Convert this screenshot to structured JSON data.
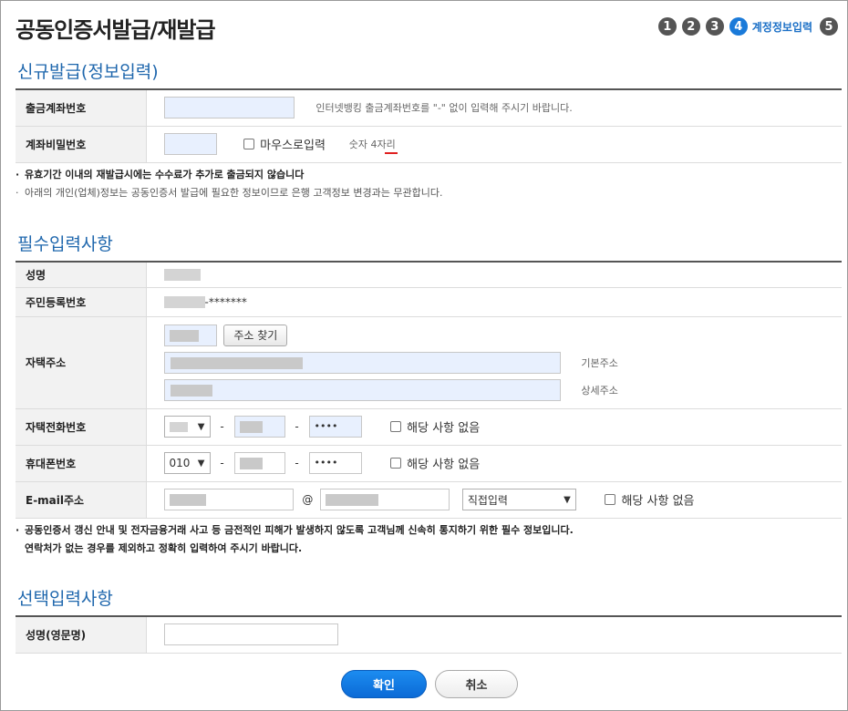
{
  "page_title": "공동인증서발급/재발급",
  "steps": {
    "items": [
      "1",
      "2",
      "3",
      "4",
      "5"
    ],
    "active_label": "계정정보입력"
  },
  "section1": {
    "title": "신규발급(정보입력)",
    "account_number_label": "출금계좌번호",
    "account_number_hint": "인터넷뱅킹 출금계좌번호를 \"-\" 없이 입력해 주시기 바랍니다.",
    "account_password_label": "계좌비밀번호",
    "mouse_input_label": "마우스로입력",
    "password_hint": "숫자 4자리",
    "note1": "유효기간 이내의 재발급시에는 수수료가 추가로 출금되지 않습니다",
    "note2": "아래의 개인(업체)정보는 공동인증서 발급에 필요한 정보이므로 은행 고객정보 변경과는 무관합니다."
  },
  "section2": {
    "title": "필수입력사항",
    "name_label": "성명",
    "rrn_label": "주민등록번호",
    "rrn_suffix": "-*******",
    "address_label": "자택주소",
    "address_search_button": "주소 찾기",
    "basic_address_label": "기본주소",
    "detail_address_label": "상세주소",
    "home_phone_label": "자택전화번호",
    "home_phone_last": "••••",
    "not_applicable": "해당 사항 없음",
    "mobile_label": "휴대폰번호",
    "mobile_prefix": "010",
    "mobile_last": "••••",
    "email_label": "E-mail주소",
    "email_at": "@",
    "email_domain_select": "직접입력",
    "dash": "-",
    "note1": "공동인증서 갱신 안내 및 전자금융거래 사고 등 금전적인 피해가 발생하지 않도록 고객님께 신속히 통지하기 위한 필수 정보입니다.",
    "note2": "연락처가 없는 경우를 제외하고 정확히 입력하여 주시기 바랍니다."
  },
  "section3": {
    "title": "선택입력사항",
    "english_name_label": "성명(영문명)"
  },
  "buttons": {
    "confirm": "확인",
    "cancel": "취소"
  },
  "colors": {
    "accent": "#1a7ad9",
    "section_title": "#1f67ad",
    "input_fill": "#e8f0fe"
  }
}
